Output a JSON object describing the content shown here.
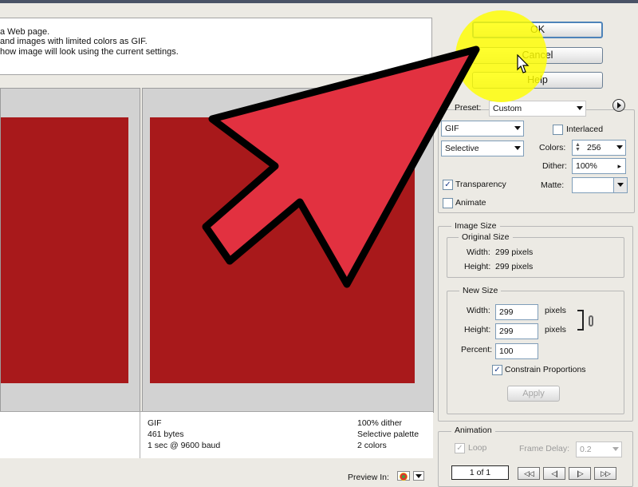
{
  "info": {
    "lines": [
      "a Web page.",
      "and images with limited colors as GIF.",
      "how image will look using the current settings."
    ]
  },
  "right_pane": {
    "format": "GIF",
    "size": "461 bytes",
    "time": "1 sec @ 9600 baud",
    "dither": "100% dither",
    "palette": "Selective palette",
    "colors": "2 colors"
  },
  "buttons": {
    "ok": "OK",
    "cancel": "Cancel",
    "help": "Help"
  },
  "settings": {
    "preset_label": "Preset:",
    "preset_value": "Custom",
    "format_value": "GIF",
    "reduction_value": "Selective",
    "interlaced_label": "Interlaced",
    "colors_label": "Colors:",
    "colors_value": "256",
    "dither_label": "Dither:",
    "dither_value": "100%",
    "transparency_label": "Transparency",
    "matte_label": "Matte:",
    "animate_label": "Animate"
  },
  "image_size": {
    "title": "Image Size",
    "original_title": "Original Size",
    "orig_width_label": "Width:",
    "orig_width_value": "299 pixels",
    "orig_height_label": "Height:",
    "orig_height_value": "299 pixels",
    "new_title": "New Size",
    "width_label": "Width:",
    "width_value": "299",
    "height_label": "Height:",
    "height_value": "299",
    "pixels_unit": "pixels",
    "percent_label": "Percent:",
    "percent_value": "100",
    "constrain_label": "Constrain Proportions",
    "apply_label": "Apply"
  },
  "animation": {
    "title": "Animation",
    "loop_label": "Loop",
    "frame_delay_label": "Frame Delay:",
    "frame_delay_value": "0.2",
    "frame_counter": "1 of 1",
    "nav": {
      "first": "◁◁",
      "prev": "◁|",
      "next": "|▷",
      "last": "▷▷"
    }
  },
  "preview": {
    "label": "Preview In:"
  },
  "colors": {
    "swatch": "#a8191b",
    "arrow_fill": "#e23140",
    "highlight": "#ffff00"
  }
}
